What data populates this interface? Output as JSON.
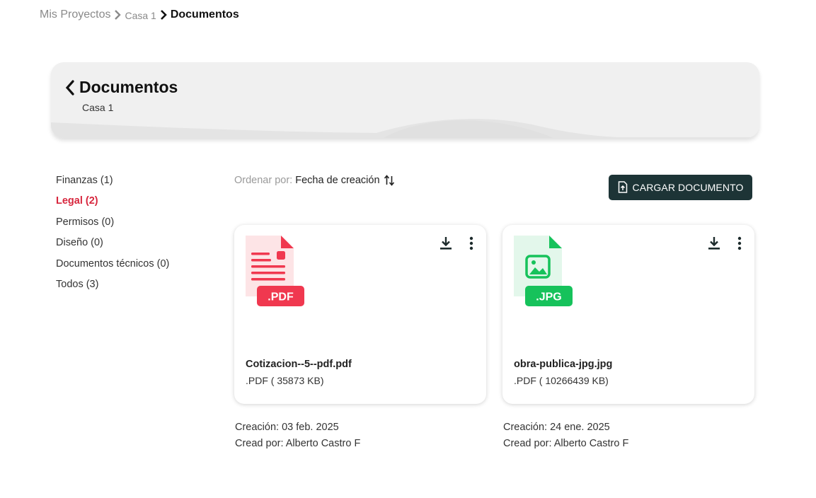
{
  "breadcrumb": {
    "items": [
      "Mis Proyectos",
      "Casa 1",
      "Documentos"
    ]
  },
  "header": {
    "title": "Documentos",
    "subtitle": "Casa 1"
  },
  "categories": [
    {
      "label": "Finanzas (1)"
    },
    {
      "label": "Legal (2)",
      "active": true
    },
    {
      "label": "Permisos (0)"
    },
    {
      "label": "Diseño (0)"
    },
    {
      "label": "Documentos técnicos (0)"
    },
    {
      "label": "Todos (3)"
    }
  ],
  "sort": {
    "label": "Ordenar por:",
    "value": "Fecha de creación"
  },
  "upload_button": {
    "label": "CARGAR DOCUMENTO"
  },
  "documents": [
    {
      "file_badge": ".PDF",
      "file_name": "Cotizacion--5--pdf.pdf",
      "file_meta": ".PDF ( 35873 KB)",
      "created": "Creación: 03 feb. 2025",
      "author": "Cread por: Alberto Castro F",
      "color": "#f0384f"
    },
    {
      "file_badge": ".JPG",
      "file_name": "obra-publica-jpg.jpg",
      "file_meta": ".PDF ( 10266439 KB)",
      "created": "Creación: 24 ene. 2025",
      "author": "Cread por: Alberto Castro F",
      "color": "#16c25b"
    }
  ],
  "colors": {
    "accent": "#d7263d",
    "button_bg": "#1d3436",
    "pdf": "#f0384f",
    "jpg": "#16c25b"
  }
}
